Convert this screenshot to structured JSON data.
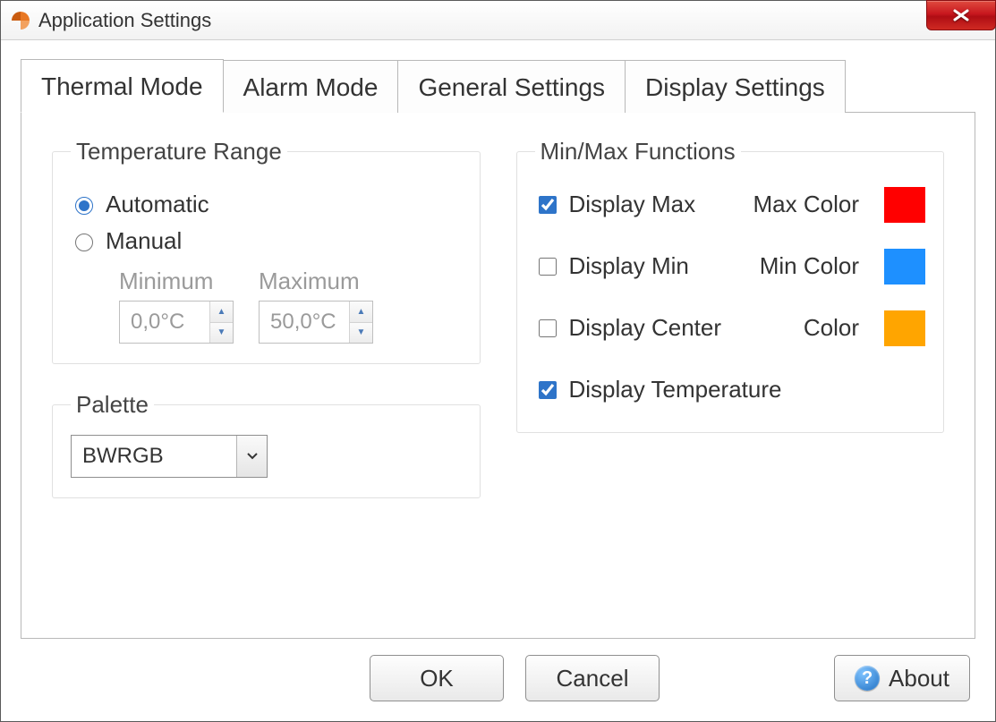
{
  "window": {
    "title": "Application Settings"
  },
  "tabs": [
    {
      "label": "Thermal Mode",
      "active": true
    },
    {
      "label": "Alarm Mode",
      "active": false
    },
    {
      "label": "General Settings",
      "active": false
    },
    {
      "label": "Display Settings",
      "active": false
    }
  ],
  "temp_range": {
    "legend": "Temperature Range",
    "automatic_label": "Automatic",
    "manual_label": "Manual",
    "mode": "automatic",
    "min_label": "Minimum",
    "max_label": "Maximum",
    "min_value": "0,0°C",
    "max_value": "50,0°C"
  },
  "palette": {
    "legend": "Palette",
    "value": "BWRGB"
  },
  "minmax": {
    "legend": "Min/Max Functions",
    "display_max_label": "Display Max",
    "display_min_label": "Display Min",
    "display_center_label": "Display Center",
    "display_temp_label": "Display Temperature",
    "display_max_checked": true,
    "display_min_checked": false,
    "display_center_checked": false,
    "display_temp_checked": true,
    "max_color_label": "Max Color",
    "min_color_label": "Min Color",
    "center_color_label": "Color",
    "max_color": "#ff0000",
    "min_color": "#1e90ff",
    "center_color": "#ffa500"
  },
  "buttons": {
    "ok": "OK",
    "cancel": "Cancel",
    "about": "About"
  }
}
